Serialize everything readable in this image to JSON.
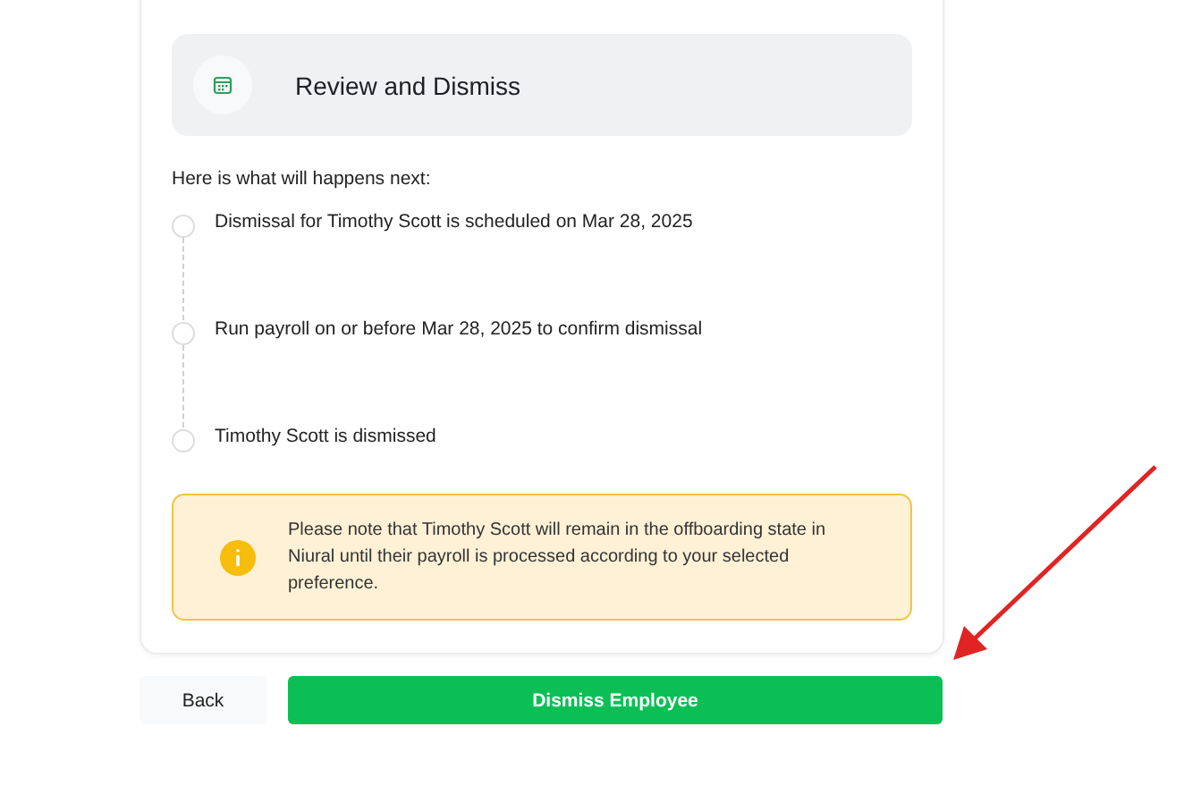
{
  "header": {
    "title": "Review and Dismiss"
  },
  "intro": "Here is what will happens next:",
  "steps": [
    {
      "text": "Dismissal for Timothy Scott is scheduled on Mar 28, 2025"
    },
    {
      "text": "Run payroll on or before Mar 28, 2025 to confirm dismissal"
    },
    {
      "text": "Timothy Scott is dismissed"
    }
  ],
  "notice": {
    "text": "Please note that Timothy Scott will remain in the offboarding state in Niural until their payroll is processed according to your selected preference."
  },
  "buttons": [
    {
      "label": "Back",
      "kind": "secondary"
    },
    {
      "label": "Dismiss Employee",
      "kind": "primary"
    }
  ]
}
